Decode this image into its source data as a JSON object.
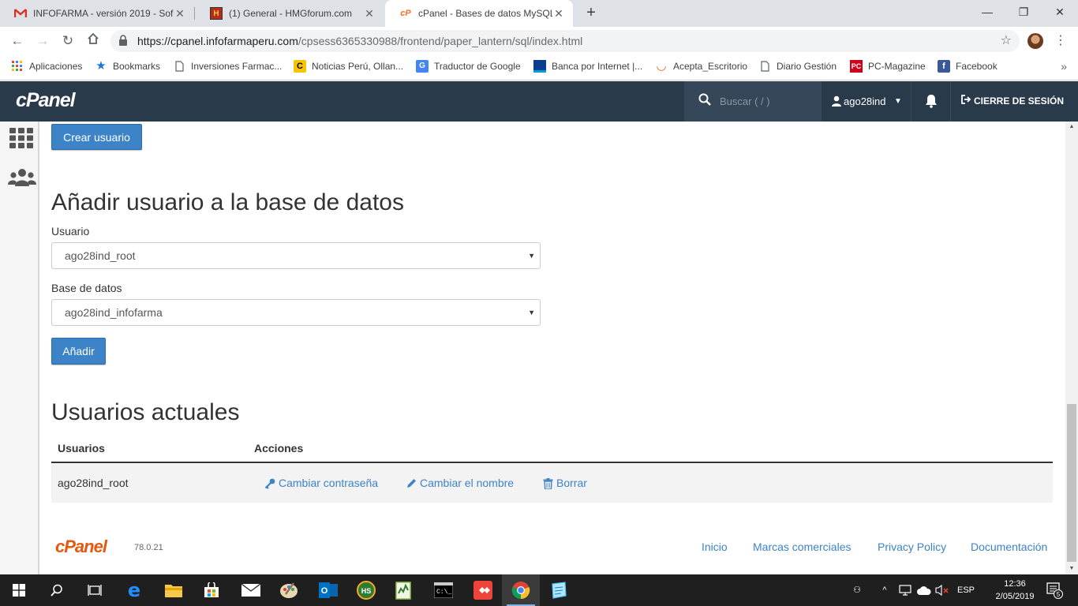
{
  "browser": {
    "tabs": [
      {
        "title": "INFOFARMA - versión 2019 - Sof",
        "icon": "gmail-icon",
        "active": false
      },
      {
        "title": "(1) General - HMGforum.com",
        "icon": "hmgforum-icon",
        "active": false
      },
      {
        "title": "cPanel - Bases de datos MySQL®",
        "icon": "cpanel-icon",
        "active": true
      }
    ],
    "url_host": "https://cpanel.infofarmaperu.com",
    "url_path": "/cpsess6365330988/frontend/paper_lantern/sql/index.html",
    "bookmarks": [
      {
        "label": "Aplicaciones",
        "icon": "apps-grid-icon"
      },
      {
        "label": "Bookmarks",
        "icon": "star-icon"
      },
      {
        "label": "Inversiones Farmac...",
        "icon": "page-icon"
      },
      {
        "label": "Noticias Perú, Ollan...",
        "icon": "comercio-icon"
      },
      {
        "label": "Traductor de Google",
        "icon": "translate-icon"
      },
      {
        "label": "Banca por Internet |...",
        "icon": "bank-icon"
      },
      {
        "label": "Acepta_Escritorio",
        "icon": "acepta-icon"
      },
      {
        "label": "Diario Gestión",
        "icon": "page-icon"
      },
      {
        "label": "PC-Magazine",
        "icon": "pcmag-icon"
      },
      {
        "label": "Facebook",
        "icon": "facebook-icon"
      }
    ]
  },
  "cpanel": {
    "logo": "cPanel",
    "search_placeholder": "Buscar ( / )",
    "username": "ago28ind",
    "logout_label": "CIERRE DE SESIÓN"
  },
  "main": {
    "create_user_button": "Crear usuario",
    "add_user_section": {
      "title": "Añadir usuario a la base de datos",
      "user_label": "Usuario",
      "user_value": "ago28ind_root",
      "database_label": "Base de datos",
      "database_value": "ago28ind_infofarma",
      "add_button": "Añadir"
    },
    "current_users": {
      "title": "Usuarios actuales",
      "col_users": "Usuarios",
      "col_actions": "Acciones",
      "rows": [
        {
          "user": "ago28ind_root",
          "change_password": "Cambiar contraseña",
          "rename": "Cambiar el nombre",
          "delete": "Borrar"
        }
      ]
    }
  },
  "footer": {
    "logo": "cPanel",
    "version": "78.0.21",
    "links": [
      "Inicio",
      "Marcas comerciales",
      "Privacy Policy",
      "Documentación"
    ]
  },
  "taskbar": {
    "language": "ESP",
    "time": "12:36",
    "date": "2/05/2019",
    "notifications": "5"
  },
  "colors": {
    "cpanel_bar": "#293a4a",
    "primary_button": "#3d83c7",
    "link": "#3d83c7",
    "footer_logo": "#e35a0f"
  }
}
